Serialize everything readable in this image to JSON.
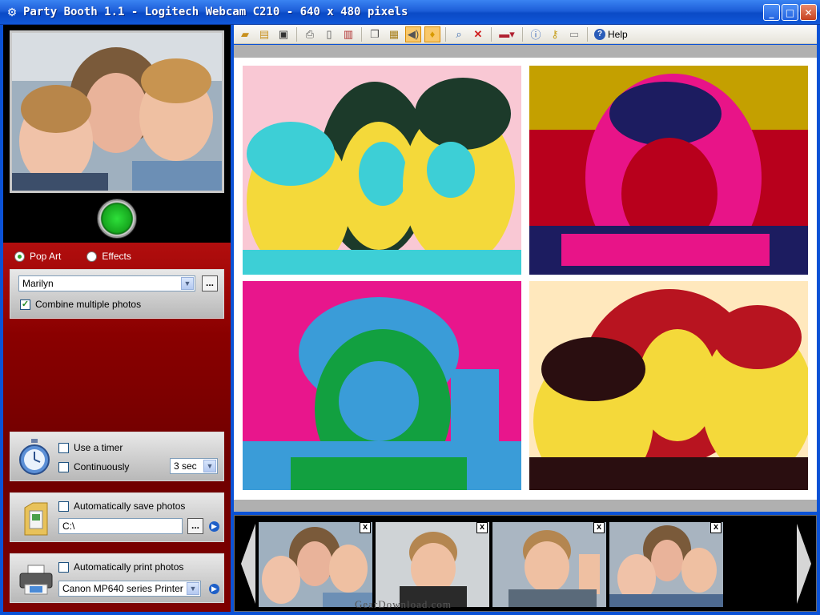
{
  "window": {
    "title": "Party Booth 1.1 - Logitech Webcam C210 - 640 x 480 pixels",
    "minimize": "_",
    "maximize": "□",
    "close": "✕"
  },
  "toolbar": {
    "icons": [
      "open-folder-icon",
      "open-file-icon",
      "save-icon",
      "print-icon",
      "print-preview-icon",
      "page-setup-icon",
      "copy-icon",
      "paste-icon",
      "sound-icon",
      "lightbulb-icon",
      "zoom-icon",
      "delete-icon",
      "language-flag-icon",
      "info-icon",
      "key-icon",
      "cart-icon",
      "help-icon"
    ],
    "help_label": "Help"
  },
  "mode": {
    "options": [
      "Pop Art",
      "Effects"
    ],
    "selected": "Pop Art"
  },
  "style_group": {
    "style_value": "Marilyn",
    "browse_label": "...",
    "combine_label": "Combine multiple photos",
    "combine_checked": true
  },
  "timer_group": {
    "use_timer_label": "Use a timer",
    "use_timer_checked": false,
    "continuously_label": "Continuously",
    "continuously_checked": false,
    "delay_value": "3 sec"
  },
  "save_group": {
    "auto_save_label": "Automatically save photos",
    "auto_save_checked": false,
    "path_value": "C:\\",
    "browse_label": "..."
  },
  "print_group": {
    "auto_print_label": "Automatically print photos",
    "auto_print_checked": false,
    "printer_value": "Canon MP640 series Printer"
  },
  "filmstrip": {
    "thumbnails": 4,
    "close_label": "x"
  },
  "watermark": "GearDownload.com",
  "colors": {
    "titlebar": "#1d5ed8",
    "red_panel": "#8a0000",
    "shutter_green": "#17a81f"
  }
}
